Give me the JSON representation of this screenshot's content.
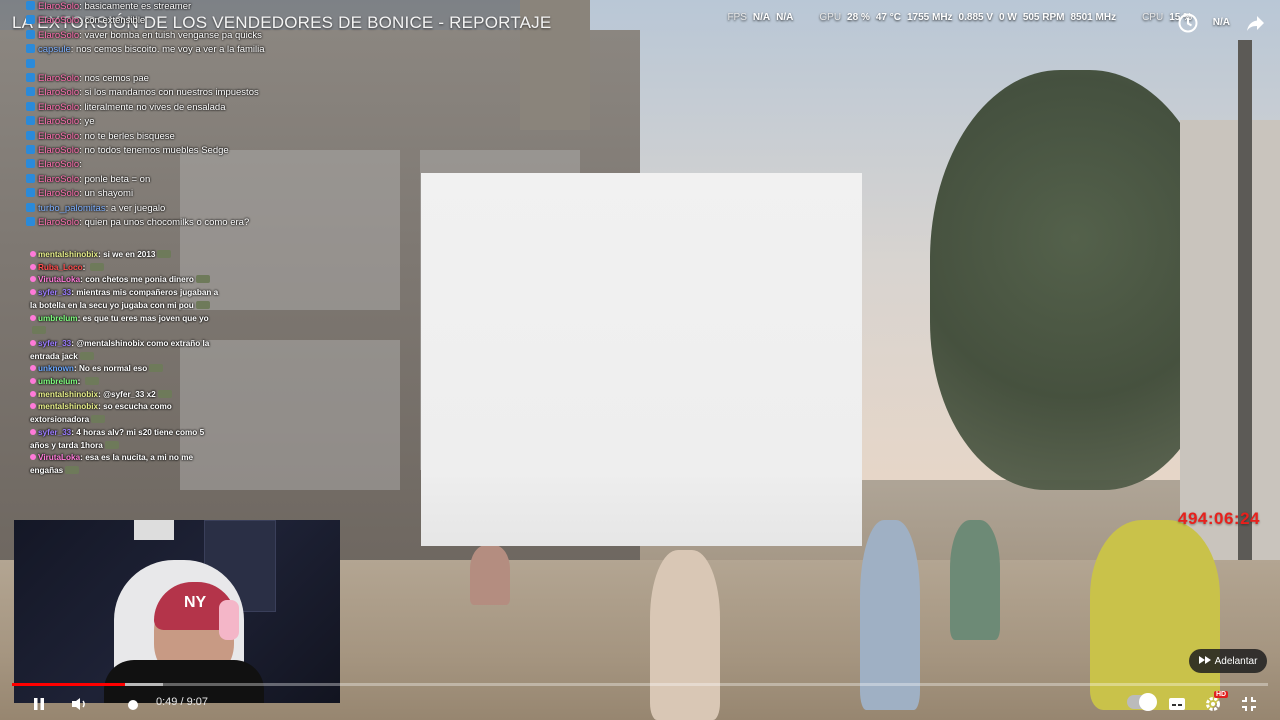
{
  "video": {
    "title": "LA EXTORSIÓN DE LOS VENDEDORES DE BONICE - REPORTAJE",
    "timer": "494:06:24",
    "time_display": "0:49 / 9:07",
    "progress": 0.09,
    "buffered": 0.12,
    "skip_label": "Adelantar"
  },
  "stats": {
    "fps_label": "FPS",
    "fps_val1": "N/A",
    "fps_val2": "N/A",
    "gpu_label": "GPU",
    "gpu_pct": "28 %",
    "gpu_temp": "47 °C",
    "gpu_clock": "1755 MHz",
    "gpu_volt": "0.885 V",
    "gpu_power": "0 W",
    "gpu_fan": "505 RPM",
    "gpu_mem": "8501 MHz",
    "cpu_label": "CPU",
    "cpu_pct": "15 %",
    "cpu_na": "N/A"
  },
  "chat_top": [
    {
      "user": "ElaroSolo",
      "text": "basicamente es streamer",
      "style": "user"
    },
    {
      "user": "ElaroSolo",
      "text": "con extensible",
      "style": "user"
    },
    {
      "user": "ElaroSolo",
      "text": "vaver bomba en tuish venganse pa quicks",
      "style": "user"
    },
    {
      "user": "capsule",
      "text": "nos cemos biscoito. me voy a ver a la familia",
      "style": "user2"
    },
    {
      "user": "",
      "text": "",
      "style": "user"
    },
    {
      "user": "ElaroSolo",
      "text": "nos cemos pae",
      "style": "user"
    },
    {
      "user": "ElaroSolo",
      "text": "si los mandamos con nuestros impuestos",
      "style": "user"
    },
    {
      "user": "ElaroSolo",
      "text": "literalmente no vives de ensalada",
      "style": "user"
    },
    {
      "user": "ElaroSolo",
      "text": "ye",
      "style": "user"
    },
    {
      "user": "ElaroSolo",
      "text": "no te berles bisquese",
      "style": "user"
    },
    {
      "user": "ElaroSolo",
      "text": "no todos tenemos muebles Sedge",
      "style": "user"
    },
    {
      "user": "ElaroSolo",
      "text": "",
      "style": "user"
    },
    {
      "user": "ElaroSolo",
      "text": "ponle beta = on",
      "style": "user"
    },
    {
      "user": "ElaroSolo",
      "text": "un shayomi",
      "style": "user"
    },
    {
      "user": "turbo_palomitas",
      "text": "a ver juegalo",
      "style": "user2"
    },
    {
      "user": "ElaroSolo",
      "text": "quien pa unos chocomilks o como era?",
      "style": "user"
    }
  ],
  "chat_bottom": [
    {
      "user": "mentalshinobix",
      "text": "si we en 2013",
      "color": "u-yellow"
    },
    {
      "user": "Ruba_Loco",
      "text": "",
      "color": "u-red"
    },
    {
      "user": "VirutaLoka",
      "text": "con chetos me ponia dinero",
      "color": "u-pink"
    },
    {
      "user": "syfer_33",
      "text": "mientras mis compañeros jugaban a la botella en la secu yo jugaba con mi pou",
      "color": "u-purple"
    },
    {
      "user": "umbrelum",
      "text": "es que tu eres mas joven que yo",
      "color": "u-green"
    },
    {
      "user": "syfer_33",
      "text": "@mentalshinobix como extraño la entrada jack",
      "color": "u-purple"
    },
    {
      "user": "unknown",
      "text": "No es normal eso",
      "color": "u-blue"
    },
    {
      "user": "umbrelum",
      "text": "",
      "color": "u-green"
    },
    {
      "user": "mentalshinobix",
      "text": "@syfer_33 x2",
      "color": "u-yellow"
    },
    {
      "user": "mentalshinobix",
      "text": "so escucha como extorsionadora",
      "color": "u-yellow"
    },
    {
      "user": "syfer_33",
      "text": "4 horas alv? mi s20 tiene como 5 años y tarda 1hora",
      "color": "u-purple"
    },
    {
      "user": "VirutaLoka",
      "text": "esa es la nucita, a mi no me engañas",
      "color": "u-pink"
    }
  ],
  "cam_logo": "NY",
  "colors": {
    "progress": "#ff0000",
    "timer": "#e8201c"
  }
}
